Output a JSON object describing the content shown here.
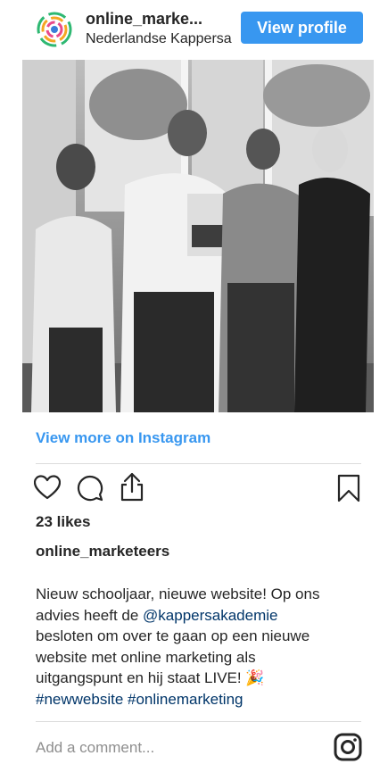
{
  "header": {
    "account_name": "online_marke...",
    "account_subtitle": "Nederlandse Kappersa",
    "view_profile_label": "View profile"
  },
  "photo": {
    "alt": ""
  },
  "view_more_label": "View more on Instagram",
  "actions": {
    "icons": [
      "heart-icon",
      "comment-icon",
      "share-icon",
      "bookmark-icon"
    ]
  },
  "likes_label": "23 likes",
  "caption": {
    "username": "online_marketeers",
    "line1": "Nieuw schooljaar, nieuwe website! Op ons",
    "line2_prefix": "advies heeft de ",
    "line2_mention": "@kappersakademie",
    "line3": "besloten om over te gaan op een nieuwe",
    "line4": "website met online marketing als",
    "line5_text": "uitgangspunt en hij staat LIVE! ",
    "line5_emoji": "🎉",
    "hashtag1": "#newwebsite",
    "hashtag2": "#onlinemarketing"
  },
  "comment": {
    "placeholder": "Add a comment..."
  },
  "colors": {
    "accent": "#3897f0",
    "link": "#003569",
    "muted": "#8e8e8e",
    "divider": "#dbdbdb"
  }
}
